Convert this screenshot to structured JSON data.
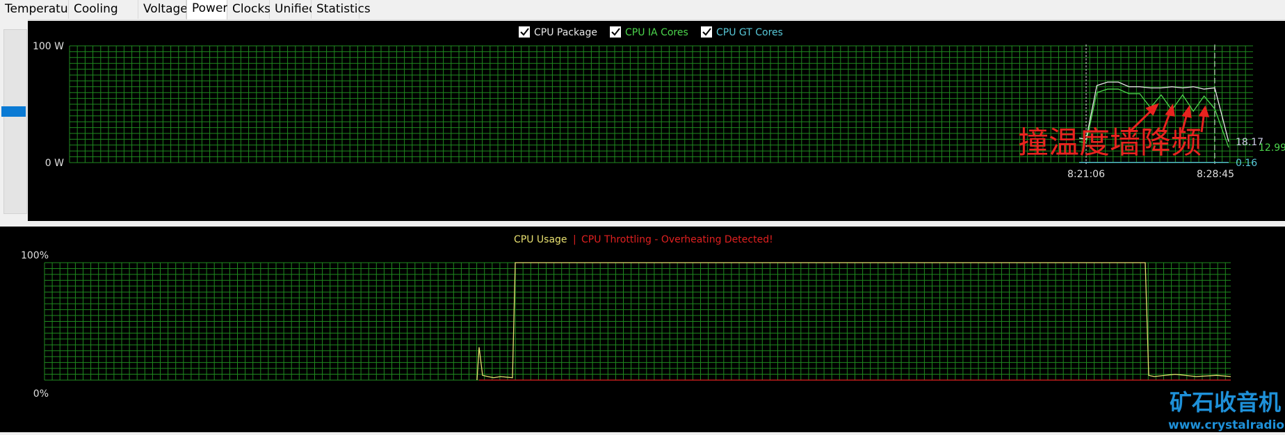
{
  "tabs": [
    {
      "label": "Temperatures",
      "active": false
    },
    {
      "label": "Cooling Fans",
      "active": false
    },
    {
      "label": "Voltages",
      "active": false
    },
    {
      "label": "Powers",
      "active": true
    },
    {
      "label": "Clocks",
      "active": false
    },
    {
      "label": "Unified",
      "active": false
    },
    {
      "label": "Statistics",
      "active": false
    }
  ],
  "power_chart": {
    "legend": [
      {
        "label": "CPU Package",
        "checked": true,
        "color": "#e8e8e8"
      },
      {
        "label": "CPU IA Cores",
        "checked": true,
        "color": "#4cd64c"
      },
      {
        "label": "CPU GT Cores",
        "checked": true,
        "color": "#58c8d8"
      }
    ],
    "y_top_label": "100 W",
    "y_bottom_label": "0 W",
    "time_start": "8:21:06",
    "time_end": "8:28:45",
    "current_values": {
      "package": "18.17",
      "ia_cores": "12.99",
      "gt_cores": "0.16"
    },
    "annotation": "撞温度墙降频",
    "annotation_color": "#e8231f"
  },
  "usage_chart": {
    "legend_usage": "CPU Usage",
    "legend_separator": "|",
    "legend_throttle": "CPU Throttling - Overheating Detected!",
    "usage_color": "#e8e070",
    "throttle_color": "#e02020",
    "y_top_label": "100%",
    "y_bottom_label": "0%"
  },
  "watermark": {
    "title": "矿石收音机",
    "url": "www.crystalradio.cn",
    "color": "#1e90d8"
  },
  "colors": {
    "grid": "#1f8a1f",
    "background": "#000000"
  },
  "chart_data": [
    {
      "type": "line",
      "ylabel": "",
      "ylim": [
        0,
        100
      ],
      "x_labels": [
        "8:21:06",
        "8:28:45"
      ],
      "series": [
        {
          "name": "CPU Package",
          "values": [
            21,
            20,
            66,
            69,
            69,
            65,
            65,
            64,
            64,
            65,
            64,
            65,
            63,
            64,
            18
          ]
        },
        {
          "name": "CPU IA Cores",
          "values": [
            18,
            17,
            60,
            63,
            63,
            59,
            59,
            47,
            58,
            45,
            58,
            44,
            57,
            46,
            13
          ]
        },
        {
          "name": "CPU GT Cores",
          "values": [
            0.2,
            0.2,
            0.2,
            0.2,
            0.2,
            0.2,
            0.2,
            0.2,
            0.2,
            0.2,
            0.2,
            0.2,
            0.2,
            0.2,
            0.16
          ]
        }
      ]
    },
    {
      "type": "line",
      "ylim": [
        0,
        100
      ],
      "series": [
        {
          "name": "CPU Usage",
          "values": [
            0,
            0,
            0,
            28,
            4,
            2,
            3,
            2,
            100,
            100,
            100,
            100,
            100,
            100,
            100,
            4,
            3,
            5,
            3,
            4,
            3
          ]
        },
        {
          "name": "CPU Throttling - Overheating Detected!",
          "values": [
            0,
            0,
            0,
            0,
            0,
            0,
            0,
            0,
            0,
            0,
            0,
            0,
            0,
            0,
            0,
            0,
            0,
            0,
            0,
            0,
            0
          ]
        }
      ]
    }
  ]
}
